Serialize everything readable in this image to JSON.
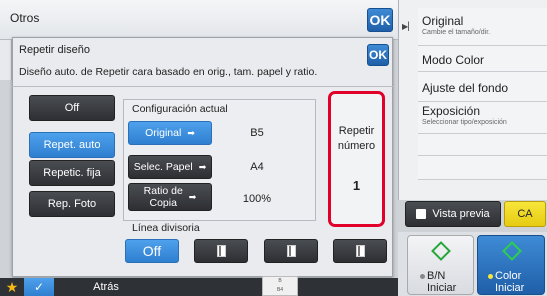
{
  "window": {
    "title": "Otros",
    "ok_label": "OK"
  },
  "right_panel": {
    "items": [
      {
        "label": "Original",
        "sub": "Cambie el tamaño/dir."
      },
      {
        "label": "Modo Color",
        "sub": ""
      },
      {
        "label": "Ajuste del fondo",
        "sub": ""
      },
      {
        "label": "Exposición",
        "sub": "Seleccionar tipo/exposición"
      }
    ]
  },
  "dialog": {
    "title": "Repetir diseño",
    "ok_label": "OK",
    "description": "Diseño auto. de Repetir cara basado en orig., tam. papel y ratio.",
    "modes": [
      {
        "label": "Off",
        "active": false
      },
      {
        "label": "Repet. auto",
        "active": true
      },
      {
        "label": "Repetic. fija",
        "active": false
      },
      {
        "label": "Rep. Foto",
        "active": false
      }
    ],
    "current_config": {
      "title": "Configuración actual",
      "rows": [
        {
          "button": "Original",
          "value": "B5"
        },
        {
          "button": "Selec. Papel",
          "value": "A4"
        },
        {
          "button_line1": "Ratio de",
          "button_line2": "Copia",
          "value": "100%"
        }
      ]
    },
    "repeat": {
      "label_line1": "Repetir",
      "label_line2": "número",
      "value": "1"
    },
    "divider": {
      "label": "Línea divisoria",
      "off_label": "Off"
    }
  },
  "bottom": {
    "back_label": "Atrás",
    "thumb_lines": [
      "B",
      "B4",
      "A3"
    ]
  },
  "actions": {
    "preview_label": "Vista previa",
    "ca_label": "CA",
    "bw_line1": "B/N",
    "bw_line2": "Iniciar",
    "color_line1": "Color",
    "color_line2": "Iniciar"
  },
  "colors": {
    "accent_blue": "#2f7fd0",
    "highlight_red": "#e0002a",
    "ca_yellow": "#e7cb11",
    "start_green": "#26a63a"
  }
}
